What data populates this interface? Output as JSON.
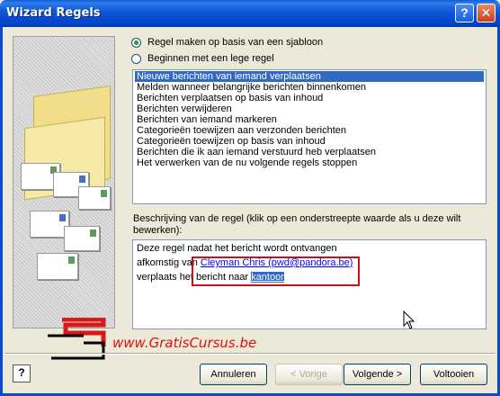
{
  "window": {
    "title": "Wizard Regels",
    "help_glyph": "?",
    "close_glyph": "✕"
  },
  "options": {
    "template": {
      "label": "Regel maken op basis van een sjabloon",
      "selected": true
    },
    "blank": {
      "label": "Beginnen met een lege regel",
      "selected": false
    }
  },
  "rule_list": {
    "items": [
      "Nieuwe berichten van iemand verplaatsen",
      "Melden wanneer belangrijke berichten binnenkomen",
      "Berichten verplaatsen op basis van inhoud",
      "Berichten verwijderen",
      "Berichten van iemand markeren",
      "Categorieën toewijzen aan verzonden berichten",
      "Categorieën toewijzen op basis van inhoud",
      "Berichten die ik aan iemand verstuurd heb verplaatsen",
      "Het verwerken van de nu volgende regels stoppen"
    ],
    "selected_index": 0
  },
  "description": {
    "label": "Beschrijving van de regel (klik op een onderstreepte waarde als u deze wilt bewerken):",
    "line1": "Deze regel nadat het bericht wordt ontvangen",
    "line2_prefix": "afkomstig van ",
    "line2_link": "Cleyman Chris (pwd@pandora.be)",
    "line3_prefix": "verplaats het bericht naar ",
    "line3_link": "kantoor"
  },
  "watermark": {
    "text": "www.GratisCursus.be"
  },
  "buttons": {
    "help": "?",
    "cancel": "Annuleren",
    "back": "< Vorige",
    "next": "Volgende >",
    "finish": "Voltooien"
  },
  "colors": {
    "title_bar": "#0054e3",
    "selection": "#316ac5",
    "link": "#0000ff",
    "highlight_box": "#cc1010",
    "watermark": "#e01010"
  }
}
